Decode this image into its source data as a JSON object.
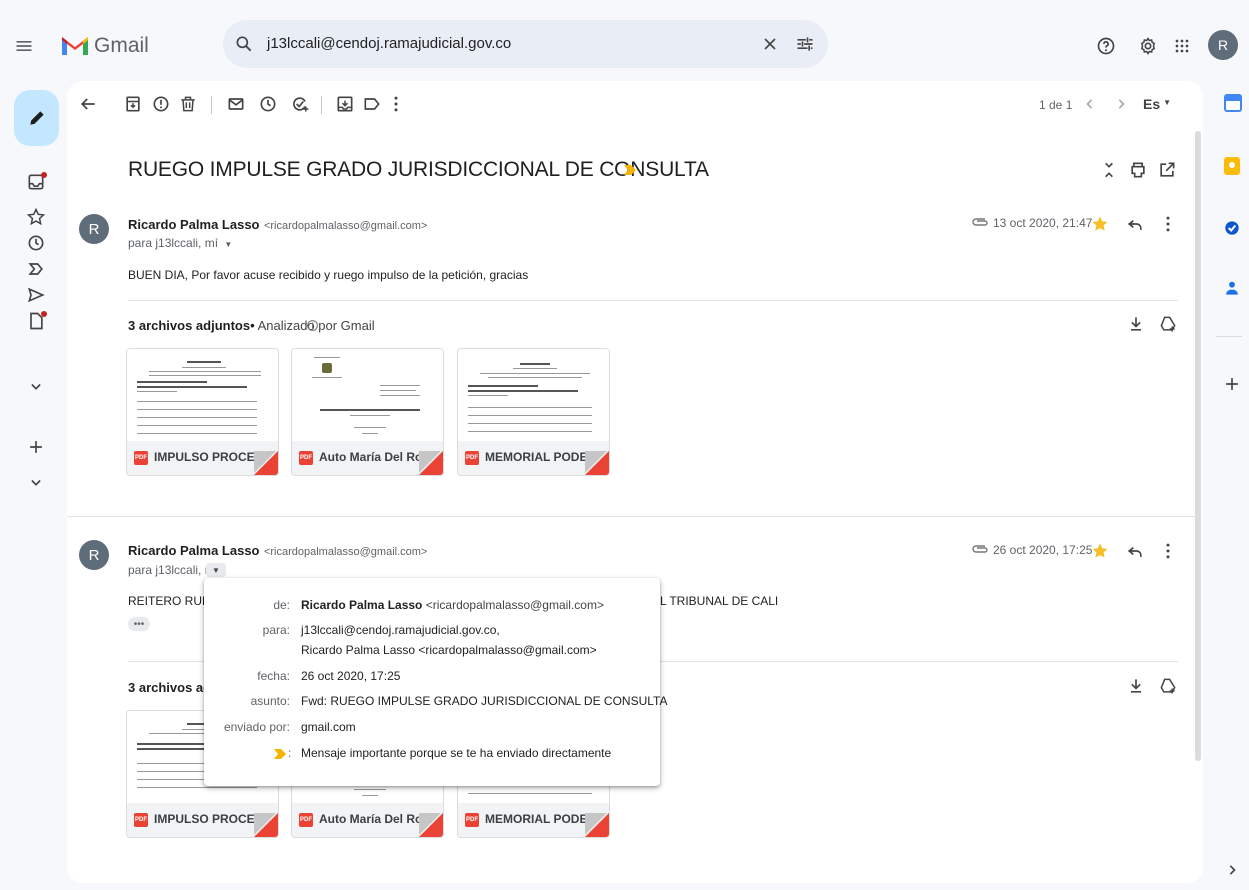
{
  "app": {
    "name": "Gmail"
  },
  "search": {
    "value": "j13lccali@cendoj.ramajudicial.gov.co"
  },
  "account": {
    "initial": "R"
  },
  "toolbar": {
    "pagination": "1 de 1",
    "language": "Es"
  },
  "thread": {
    "subject": "RUEGO IMPULSE GRADO JURISDICCIONAL DE CONSULTA"
  },
  "messages": [
    {
      "initial": "R",
      "sender_name": "Ricardo Palma Lasso",
      "sender_email": "<ricardopalmalasso@gmail.com>",
      "to_line": "para j13lccali, mí",
      "date": "13 oct 2020, 21:47",
      "body": "BUEN DIA, Por favor acuse recibido y ruego impulso de la petición, gracias",
      "attachments_title": "3 archivos adjuntos",
      "attachments_sub": "Analizado por Gmail",
      "attachments": [
        "IMPULSO PROCE...",
        "Auto María Del Ro...",
        "MEMORIAL PODE..."
      ]
    },
    {
      "initial": "R",
      "sender_name": "Ricardo Palma Lasso",
      "sender_email": "<ricardopalmalasso@gmail.com>",
      "to_line": "para j13lccali, mí",
      "date": "26 oct 2020, 17:25",
      "body_start": "REITERO RUEC",
      "body_end": "L TRIBUNAL DE CALI",
      "more": "•••",
      "attachments_title": "3 archivos adj",
      "attachments": [
        "IMPULSO PROCE...",
        "Auto María Del Ro...",
        "MEMORIAL PODE..."
      ]
    }
  ],
  "details_popup": {
    "from_label": "de:",
    "from_name": "Ricardo Palma Lasso",
    "from_email": "<ricardopalmalasso@gmail.com>",
    "to_label": "para:",
    "to_1": "j13lccali@cendoj.ramajudicial.gov.co,",
    "to_2": "Ricardo Palma Lasso <ricardopalmalasso@gmail.com>",
    "date_label": "fecha:",
    "date": "26 oct 2020, 17:25",
    "subject_label": "asunto:",
    "subject": "Fwd: RUEGO IMPULSE GRADO JURISDICCIONAL DE CONSULTA",
    "mailed_by_label": "enviado por:",
    "mailed_by": "gmail.com",
    "importance_label": ":",
    "importance": "Mensaje importante porque se te ha enviado directamente"
  },
  "colors": {
    "accent_blue": "#0b57d0",
    "star": "#f6bf26",
    "importance": "#f4b400",
    "pdf_red": "#ea4335",
    "badge_red": "#c5221f"
  }
}
